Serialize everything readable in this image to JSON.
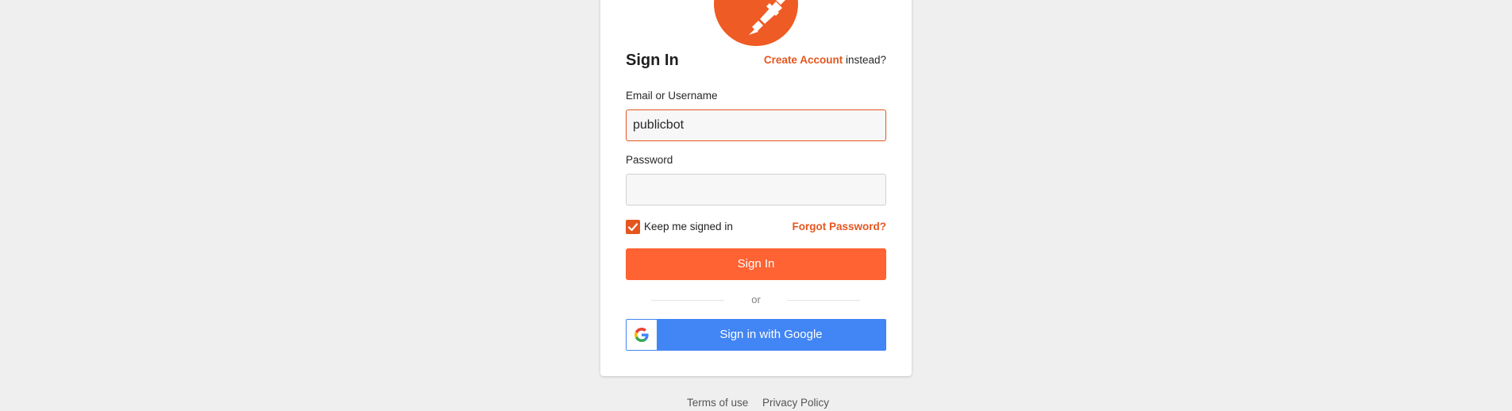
{
  "colors": {
    "accent": "#e5561f",
    "button": "#ff6233",
    "logo": "#ef5b25",
    "google_blue": "#4285f4",
    "background": "#efefef"
  },
  "logo": {
    "icon": "postman-astronaut-icon"
  },
  "form": {
    "title": "Sign In",
    "create_account_link": "Create Account",
    "create_account_suffix": " instead?",
    "email_label": "Email or Username",
    "email_value": "publicbot",
    "password_label": "Password",
    "password_value": "",
    "keep_signed_in_label": "Keep me signed in",
    "keep_signed_in_checked": true,
    "forgot_password": "Forgot Password?",
    "submit_label": "Sign In",
    "divider_text": "or",
    "google_label": "Sign in with Google",
    "google_icon": "google-g-icon"
  },
  "footer": {
    "terms": "Terms of use",
    "privacy": "Privacy Policy"
  }
}
